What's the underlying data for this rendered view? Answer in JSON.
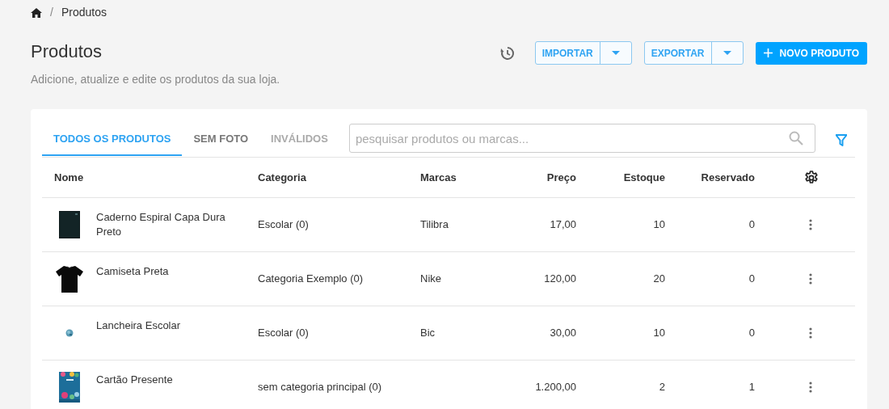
{
  "breadcrumb_separator": "/",
  "breadcrumb": [
    "Produtos"
  ],
  "page": {
    "title": "Produtos",
    "subtitle": "Adicione, atualize e edite os produtos da sua loja."
  },
  "actions": {
    "import": "IMPORTAR",
    "export": "EXPORTAR",
    "new": "NOVO PRODUTO"
  },
  "tabs": [
    {
      "label": "TODOS OS PRODUTOS",
      "selected": true
    },
    {
      "label": "SEM FOTO",
      "selected": false
    },
    {
      "label": "INVÁLIDOS",
      "selected": false,
      "disabled": true
    }
  ],
  "search": {
    "placeholder": "pesquisar produtos ou marcas..."
  },
  "table": {
    "columns": [
      "Nome",
      "Categoria",
      "Marcas",
      "Preço",
      "Estoque",
      "Reservado"
    ],
    "rows": [
      {
        "name": "Caderno Espiral Capa Dura Preto",
        "category": "Escolar (0)",
        "brand": "Tilibra",
        "price": "17,00",
        "stock": "10",
        "reserved": "0"
      },
      {
        "name": "Camiseta Preta",
        "category": "Categoria Exemplo (0)",
        "brand": "Nike",
        "price": "120,00",
        "stock": "20",
        "reserved": "0"
      },
      {
        "name": "Lancheira Escolar",
        "category": "Escolar (0)",
        "brand": "Bic",
        "price": "30,00",
        "stock": "10",
        "reserved": "0"
      },
      {
        "name": "Cartão Presente",
        "category": "sem categoria principal (0)",
        "price": "1.200,00",
        "stock": "2",
        "reserved": "1"
      }
    ]
  }
}
